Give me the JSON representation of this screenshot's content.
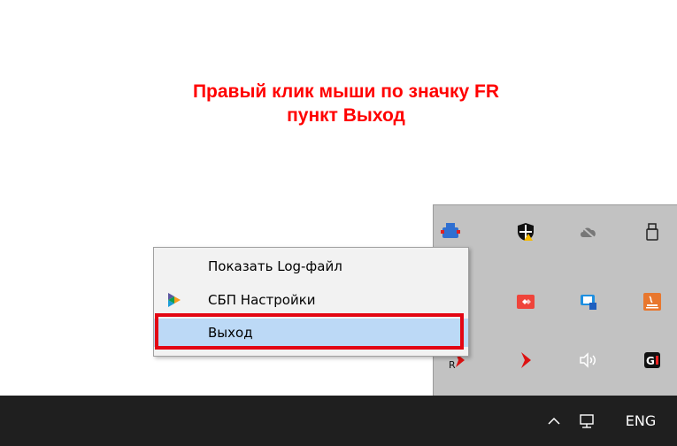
{
  "instruction": {
    "line1": "Правый клик мыши по значку FR",
    "line2": "пункт Выход"
  },
  "context_menu": {
    "items": [
      {
        "label": "Показать Log-файл",
        "icon": null
      },
      {
        "label": "СБП Настройки",
        "icon": "sbp-logo-icon"
      },
      {
        "label": "Выход",
        "icon": null,
        "selected": true
      }
    ]
  },
  "tray_flyout": {
    "icons": [
      "app-icon-blue",
      "defender-shield-icon",
      "cloud-off-icon",
      "usb-drive-icon",
      "app-icon-blue-2",
      "anydesk-icon",
      "teams-icon",
      "java-update-icon",
      "fr-icon",
      "arrow-app-icon",
      "volume-icon",
      "g-app-icon"
    ]
  },
  "taskbar": {
    "language": "ENG",
    "icons": [
      "chevron-up-icon",
      "network-icon"
    ]
  },
  "colors": {
    "instruction_text": "#ff0000",
    "highlight_border": "#e30613",
    "menu_selected": "#bcd9f6",
    "taskbar": "#1f1f1f",
    "flyout": "#c2c2c2"
  }
}
